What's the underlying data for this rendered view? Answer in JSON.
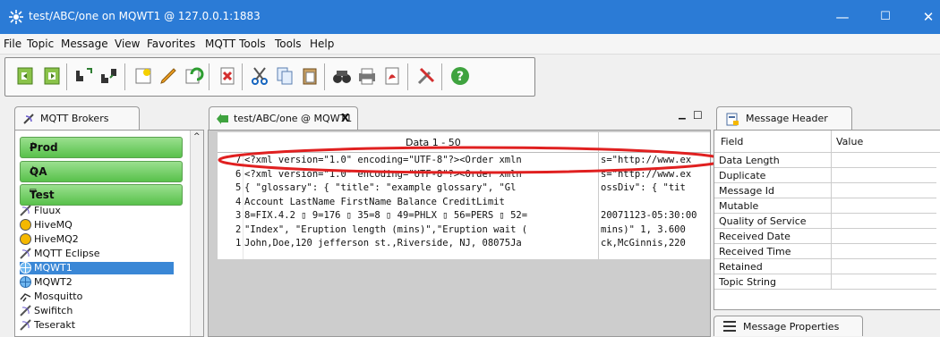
{
  "window": {
    "title": "test/ABC/one on MQWT1 @ 127.0.0.1:1883",
    "minimize": "—",
    "maximize": "☐",
    "close": "✕"
  },
  "menu": [
    "File",
    "Topic",
    "Message",
    "View",
    "Favorites",
    "MQTT Tools",
    "Tools",
    "Help"
  ],
  "toolbar": {
    "icons": [
      "import-icon",
      "export-icon",
      "connect-icon",
      "disconnect-icon",
      "new-icon",
      "edit-icon",
      "refresh-icon",
      "delete-icon",
      "cut-icon",
      "copy-icon",
      "paste-icon",
      "find-icon",
      "print-icon",
      "pdf-icon",
      "tools-icon",
      "help-icon"
    ]
  },
  "brokers_panel": {
    "title": "MQTT Brokers",
    "groups": [
      {
        "label": "Prod",
        "arrow": "△"
      },
      {
        "label": "QA",
        "arrow": "△"
      },
      {
        "label": "Test",
        "arrow": "▽"
      }
    ],
    "items": [
      "Fluux",
      "HiveMQ",
      "HiveMQ2",
      "MQTT Eclipse",
      "MQWT1",
      "MQWT2",
      "Mosquitto",
      "Swifitch",
      "Teserakt"
    ],
    "selected": "MQWT1"
  },
  "data_panel": {
    "tab_title": "test/ABC/one @ MQWT1",
    "close": "X",
    "minimize": "▁",
    "restore": "☐",
    "header": "Data 1 - 50",
    "rows": [
      {
        "num": "7",
        "col1": "<?xml version=\"1.0\" encoding=\"UTF-8\"?><Order xmln",
        "col2": "s=\"http://www.ex"
      },
      {
        "num": "6",
        "col1": "<?xml version=\"1.0\" encoding=\"UTF-8\"?><Order xmln",
        "col2": "s=\"http://www.ex"
      },
      {
        "num": "5",
        "col1": "{ \"glossary\": { \"title\": \"example glossary\", \"Gl",
        "col2": "ossDiv\": { \"tit"
      },
      {
        "num": "4",
        "col1": "Account LastName FirstName Balance CreditLimit",
        "col2": ""
      },
      {
        "num": "3",
        "col1": "8=FIX.4.2 ▯ 9=176 ▯ 35=8 ▯ 49=PHLX ▯ 56=PERS ▯ 52=",
        "col2": "20071123-05:30:00"
      },
      {
        "num": "2",
        "col1": "\"Index\", \"Eruption length (mins)\",\"Eruption wait (",
        "col2": "mins)\" 1, 3.600"
      },
      {
        "num": "1",
        "col1": "John,Doe,120 jefferson st.,Riverside, NJ, 08075Ja",
        "col2": "ck,McGinnis,220"
      }
    ]
  },
  "header_panel": {
    "title": "Message Header",
    "col_field": "Field",
    "col_value": "Value",
    "fields": [
      "Data Length",
      "Duplicate",
      "Message Id",
      "Mutable",
      "Quality of Service",
      "Received Date",
      "Received Time",
      "Retained",
      "Topic String"
    ]
  },
  "properties_panel": {
    "title": "Message Properties"
  },
  "colors": {
    "titlebar": "#2b7bd6",
    "broker_green": "#58c14b",
    "selection": "#3a87d6",
    "annotation": "#e02020"
  }
}
